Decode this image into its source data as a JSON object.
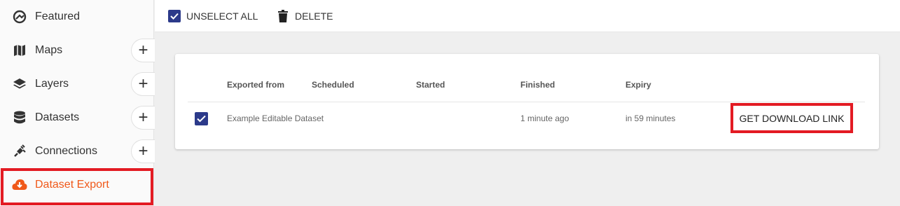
{
  "sidebar": {
    "items": [
      {
        "label": "Featured",
        "icon": "featured-icon",
        "has_add": false
      },
      {
        "label": "Maps",
        "icon": "map-icon",
        "has_add": true
      },
      {
        "label": "Layers",
        "icon": "layers-icon",
        "has_add": true
      },
      {
        "label": "Datasets",
        "icon": "database-icon",
        "has_add": true
      },
      {
        "label": "Connections",
        "icon": "plug-icon",
        "has_add": true
      },
      {
        "label": "Dataset Export",
        "icon": "cloud-download-icon",
        "has_add": false,
        "active": true
      }
    ],
    "add_symbol": "+"
  },
  "toolbar": {
    "unselect_all_label": "UNSELECT ALL",
    "delete_label": "DELETE"
  },
  "table": {
    "headers": [
      "Exported from",
      "Scheduled",
      "Started",
      "Finished",
      "Expiry"
    ],
    "rows": [
      {
        "checked": true,
        "exported_from": "Example Editable Dataset",
        "scheduled": "",
        "started": "",
        "finished": "1 minute ago",
        "expiry": "in 59 minutes",
        "action_label": "GET DOWNLOAD LINK"
      }
    ]
  },
  "colors": {
    "accent": "#f0591a",
    "checkbox": "#2c3a8a",
    "highlight": "#e31b23"
  }
}
